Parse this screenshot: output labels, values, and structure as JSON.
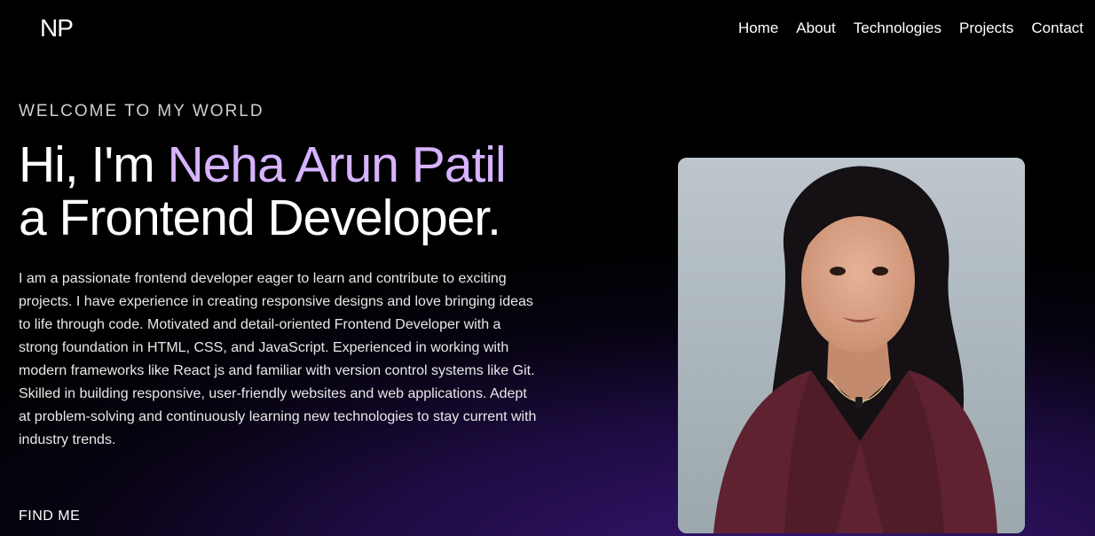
{
  "header": {
    "logo": "NP",
    "nav": [
      {
        "label": "Home"
      },
      {
        "label": "About"
      },
      {
        "label": "Technologies"
      },
      {
        "label": "Projects"
      },
      {
        "label": "Contact"
      }
    ]
  },
  "hero": {
    "eyebrow": "WELCOME TO MY WORLD",
    "greeting": "Hi, I'm ",
    "name": "Neha Arun Patil",
    "role_line": "a Frontend Developer.",
    "bio": "I am a passionate frontend developer eager to learn and contribute to exciting projects. I have experience in creating responsive designs and love bringing ideas to life through code. Motivated and detail-oriented Frontend Developer with a strong foundation in HTML, CSS, and JavaScript. Experienced in working with modern frameworks like React js and familiar with version control systems like Git. Skilled in building responsive, user-friendly websites and web applications. Adept at problem-solving and continuously learning new technologies to stay current with industry trends.",
    "find_me": "FIND ME"
  },
  "colors": {
    "accent_name": "#d6b3ff",
    "background": "#000000",
    "glow": "#3a1878"
  }
}
